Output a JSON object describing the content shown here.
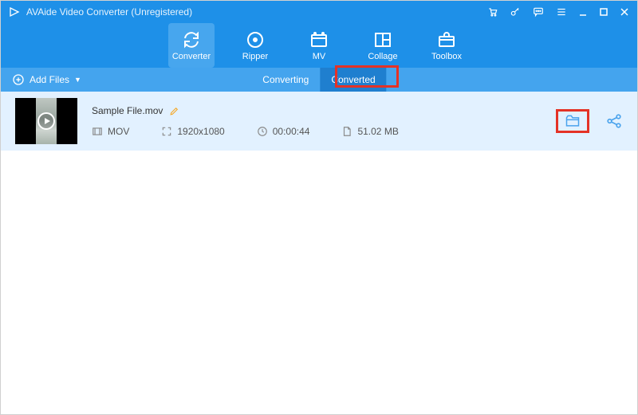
{
  "titlebar": {
    "title": "AVAide Video Converter (Unregistered)"
  },
  "toolbar": {
    "items": [
      {
        "label": "Converter"
      },
      {
        "label": "Ripper"
      },
      {
        "label": "MV"
      },
      {
        "label": "Collage"
      },
      {
        "label": "Toolbox"
      }
    ]
  },
  "subbar": {
    "add_files_label": "Add Files",
    "status_tabs": {
      "converting": "Converting",
      "converted": "Converted"
    }
  },
  "file": {
    "name": "Sample File.mov",
    "format": "MOV",
    "resolution": "1920x1080",
    "duration": "00:00:44",
    "size": "51.02 MB"
  }
}
